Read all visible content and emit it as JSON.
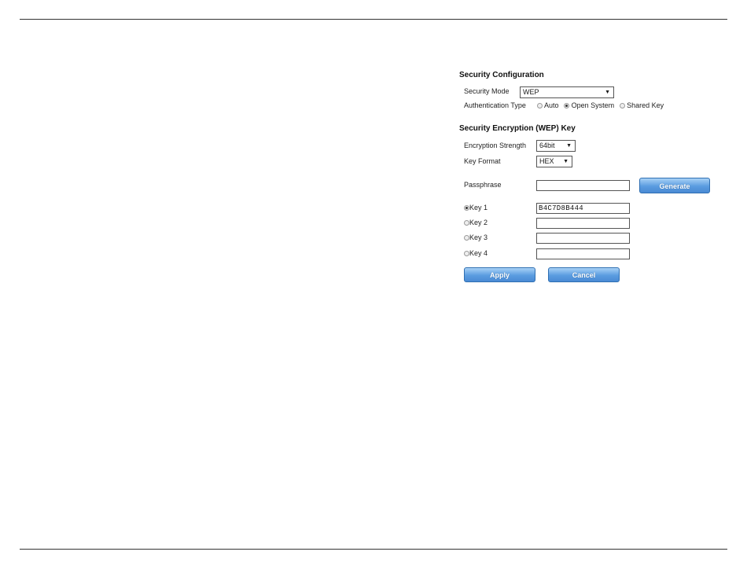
{
  "security_configuration": {
    "title": "Security Configuration",
    "mode_label": "Security Mode",
    "mode_value": "WEP",
    "auth_label": "Authentication Type",
    "auth_options": [
      {
        "label": "Auto",
        "selected": false
      },
      {
        "label": "Open System",
        "selected": true
      },
      {
        "label": "Shared Key",
        "selected": false
      }
    ]
  },
  "wep_key": {
    "title": "Security Encryption (WEP) Key",
    "strength_label": "Encryption Strength",
    "strength_value": "64bit",
    "format_label": "Key Format",
    "format_value": "HEX",
    "passphrase_label": "Passphrase",
    "passphrase_value": "",
    "generate_label": "Generate",
    "keys": [
      {
        "label": "Key 1",
        "value": "B4C7D8B444",
        "selected": true
      },
      {
        "label": "Key 2",
        "value": "",
        "selected": false
      },
      {
        "label": "Key 3",
        "value": "",
        "selected": false
      },
      {
        "label": "Key 4",
        "value": "",
        "selected": false
      }
    ]
  },
  "actions": {
    "apply_label": "Apply",
    "cancel_label": "Cancel"
  }
}
